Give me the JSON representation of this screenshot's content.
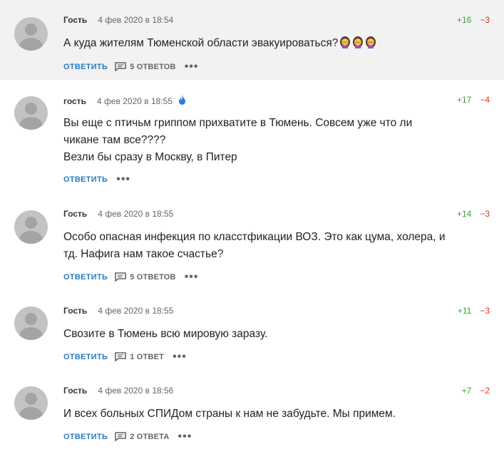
{
  "colors": {
    "reply_link": "#2a7bbf",
    "vote_up": "#3aa13a",
    "vote_down": "#d9342b",
    "highlight_bg": "#f2f2f2"
  },
  "comments": [
    {
      "author": "Гость",
      "date": "4 фев 2020 в 18:54",
      "up": "+16",
      "down": "−3",
      "lines": [
        "А куда жителям Тюменской области эвакуироваться?"
      ],
      "emoji": "woman-facepalming ×3",
      "reply_label": "ОТВЕТИТЬ",
      "replies_label": "5 ОТВЕТОВ"
    },
    {
      "author": "гость",
      "date": "4 фев 2020 в 18:55",
      "up": "+17",
      "down": "−4",
      "badge_icon": "fire-icon",
      "lines": [
        "Вы еще с птичьм гриппом прихватите в Тюмень. Совсем уже что ли",
        "чикане там все????",
        "Везли бы сразу в Москву, в Питер"
      ],
      "reply_label": "ОТВЕТИТЬ",
      "replies_label": ""
    },
    {
      "author": "Гость",
      "date": "4 фев 2020 в 18:55",
      "up": "+14",
      "down": "−3",
      "lines": [
        "Особо опасная инфекция по класстфикации ВОЗ. Это как цума, холера, и",
        "тд. Нафига нам такое счастье?"
      ],
      "reply_label": "ОТВЕТИТЬ",
      "replies_label": "5 ОТВЕТОВ"
    },
    {
      "author": "Гость",
      "date": "4 фев 2020 в 18:55",
      "up": "+11",
      "down": "−3",
      "lines": [
        "Свозите в Тюмень всю мировую заразу."
      ],
      "reply_label": "ОТВЕТИТЬ",
      "replies_label": "1 ОТВЕТ"
    },
    {
      "author": "Гость",
      "date": "4 фев 2020 в 18:56",
      "up": "+7",
      "down": "−2",
      "lines": [
        "И всех больных СПИДом страны к нам не забудьте. Мы примем."
      ],
      "reply_label": "ОТВЕТИТЬ",
      "replies_label": "2 ОТВЕТА"
    }
  ]
}
